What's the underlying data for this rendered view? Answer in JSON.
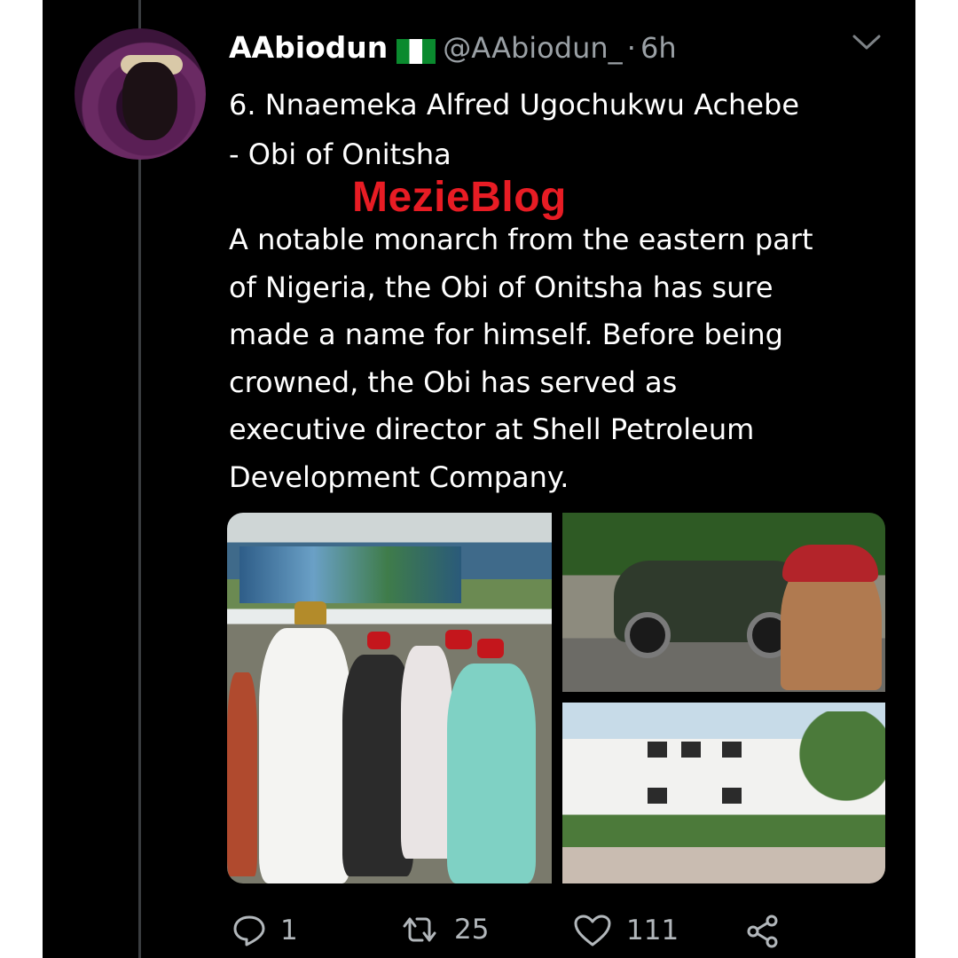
{
  "tweet": {
    "author_name": "AAbiodun",
    "flag": "nigeria-flag-icon",
    "handle": "@AAbiodun_",
    "separator": "·",
    "time": "6h",
    "title_line1": "6. Nnaemeka Alfred Ugochukwu Achebe",
    "title_line2": "- Obi of Onitsha",
    "body_lines": [
      "A notable monarch from the eastern part",
      "of Nigeria, the Obi of Onitsha has sure",
      "made a name for himself. Before being",
      "crowned, the Obi has served as",
      "executive director at Shell Petroleum",
      "Development Company."
    ],
    "watermark": "MezieBlog",
    "media": [
      "photo-main",
      "photo-car",
      "photo-house"
    ]
  },
  "actions": {
    "reply_count": "1",
    "retweet_count": "25",
    "like_count": "111"
  },
  "colors": {
    "background": "#000000",
    "text": "#ffffff",
    "secondary": "#9aa0a5",
    "watermark": "#e81c24",
    "flag_green": "#0a8a2e"
  }
}
